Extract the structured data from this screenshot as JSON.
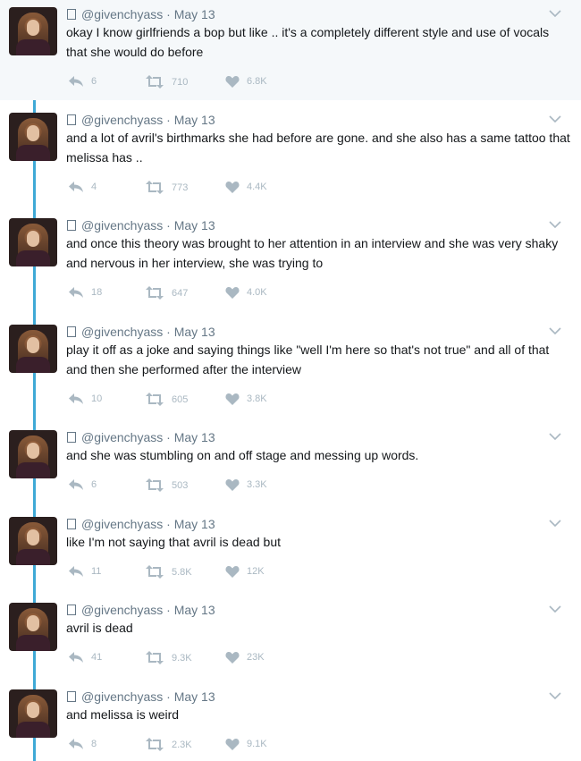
{
  "tweets": [
    {
      "handle": "@givenchyass",
      "date": "May 13",
      "text": "okay I know girlfriends a bop but like .. it's a completely different style and use of vocals that she would do before",
      "replies": "6",
      "retweets": "710",
      "likes": "6.8K"
    },
    {
      "handle": "@givenchyass",
      "date": "May 13",
      "text": "and a lot of avril's birthmarks she had before are gone. and she also has a same tattoo that melissa has ..",
      "replies": "4",
      "retweets": "773",
      "likes": "4.4K"
    },
    {
      "handle": "@givenchyass",
      "date": "May 13",
      "text": "and once this theory was brought to her attention in an interview and she was very shaky and nervous in her interview, she was trying to",
      "replies": "18",
      "retweets": "647",
      "likes": "4.0K"
    },
    {
      "handle": "@givenchyass",
      "date": "May 13",
      "text": "play it off as a joke and saying things like \"well I'm here so that's not true\" and all of that and then she performed after the interview",
      "replies": "10",
      "retweets": "605",
      "likes": "3.8K"
    },
    {
      "handle": "@givenchyass",
      "date": "May 13",
      "text": "and she was stumbling on and off stage and messing up words.",
      "replies": "6",
      "retweets": "503",
      "likes": "3.3K"
    },
    {
      "handle": "@givenchyass",
      "date": "May 13",
      "text": "like I'm not saying that avril is dead but",
      "replies": "11",
      "retweets": "5.8K",
      "likes": "12K"
    },
    {
      "handle": "@givenchyass",
      "date": "May 13",
      "text": "avril is dead",
      "replies": "41",
      "retweets": "9.3K",
      "likes": "23K"
    },
    {
      "handle": "@givenchyass",
      "date": "May 13",
      "text": "and melissa is weird",
      "replies": "8",
      "retweets": "2.3K",
      "likes": "9.1K"
    }
  ],
  "ui": {
    "separator": "·",
    "thread_line_color": "#3fa9d6",
    "first_tweet_background": "#f5f8fa",
    "icons": [
      "avatar",
      "reply-icon",
      "retweet-icon",
      "like-icon",
      "chevron-down-icon"
    ]
  }
}
